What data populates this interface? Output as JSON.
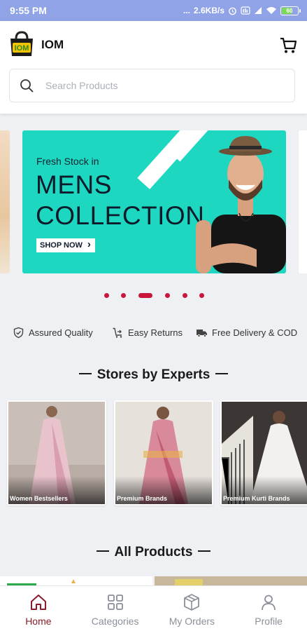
{
  "status_bar": {
    "time": "9:55 PM",
    "indicators": "...",
    "net_speed": "2.6KB/s",
    "battery_level": "60"
  },
  "header": {
    "app_name": "IOM",
    "logo_text": "IOM",
    "search_placeholder": "Search Products"
  },
  "banner": {
    "kicker": "Fresh Stock in",
    "title_line1": "MENS",
    "title_line2": "COLLECTION",
    "cta": "SHOP NOW",
    "background": "#1ed7c0",
    "slides_count": 6,
    "active_slide": 3
  },
  "features": [
    {
      "icon": "shield-check-icon",
      "label": "Assured Quality"
    },
    {
      "icon": "return-cart-icon",
      "label": "Easy Returns"
    },
    {
      "icon": "delivery-truck-icon",
      "label": "Free Delivery & COD"
    }
  ],
  "stores_section": {
    "title": "Stores by Experts",
    "stores": [
      {
        "label": "Women Bestsellers"
      },
      {
        "label": "Premium Brands"
      },
      {
        "label": "Premium Kurti Brands"
      }
    ]
  },
  "products_section": {
    "title": "All Products"
  },
  "bottom_nav": {
    "items": [
      {
        "label": "Home",
        "icon": "home-icon",
        "active": true
      },
      {
        "label": "Categories",
        "icon": "grid-icon",
        "active": false
      },
      {
        "label": "My Orders",
        "icon": "package-icon",
        "active": false
      },
      {
        "label": "Profile",
        "icon": "person-icon",
        "active": false
      }
    ]
  },
  "colors": {
    "status_bar": "#8fa3e6",
    "accent": "#8a1c2c",
    "dot": "#c8163d",
    "page_bg": "#eef0f4"
  }
}
